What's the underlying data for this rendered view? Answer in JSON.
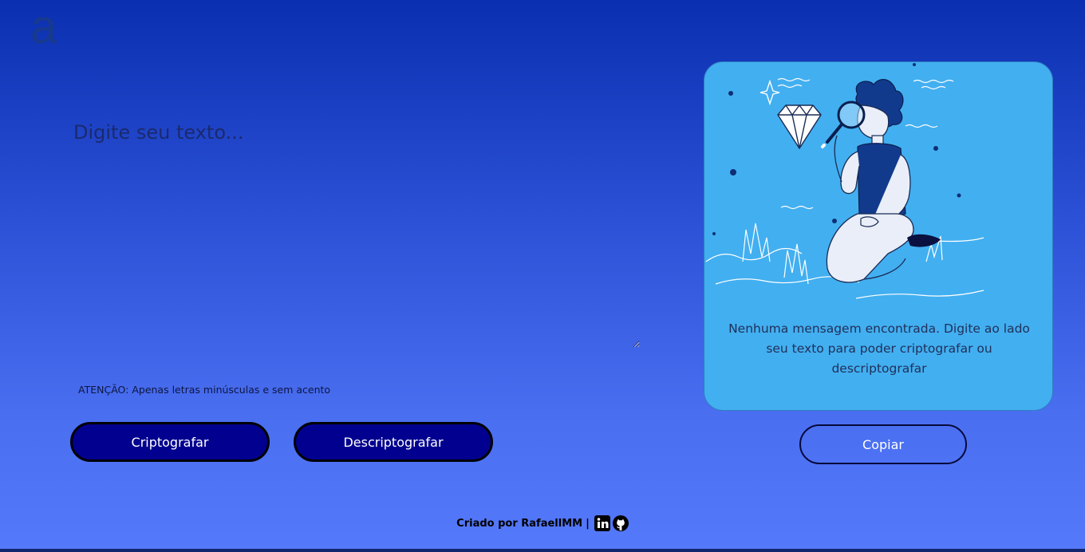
{
  "logo": {
    "letter": "a"
  },
  "input": {
    "placeholder": "Digite seu texto...",
    "value": ""
  },
  "warning": "ATENÇÃO: Apenas letras minúsculas e sem acento",
  "buttons": {
    "encrypt": "Criptografar",
    "decrypt": "Descriptografar",
    "copy": "Copiar"
  },
  "output": {
    "message": "Nenhuma mensagem encontrada. Digite ao lado seu texto para poder criptografar ou descriptografar",
    "illustration": "person-with-magnifying-glass-and-diamond"
  },
  "footer": {
    "credit": "Criado por RafaellMM",
    "separator": "|",
    "icons": [
      "linkedin-icon",
      "github-icon"
    ]
  },
  "colors": {
    "bg_top": "#0a2fb0",
    "bg_bottom": "#5579fb",
    "panel": "#42aff0",
    "button": "#02018f"
  }
}
